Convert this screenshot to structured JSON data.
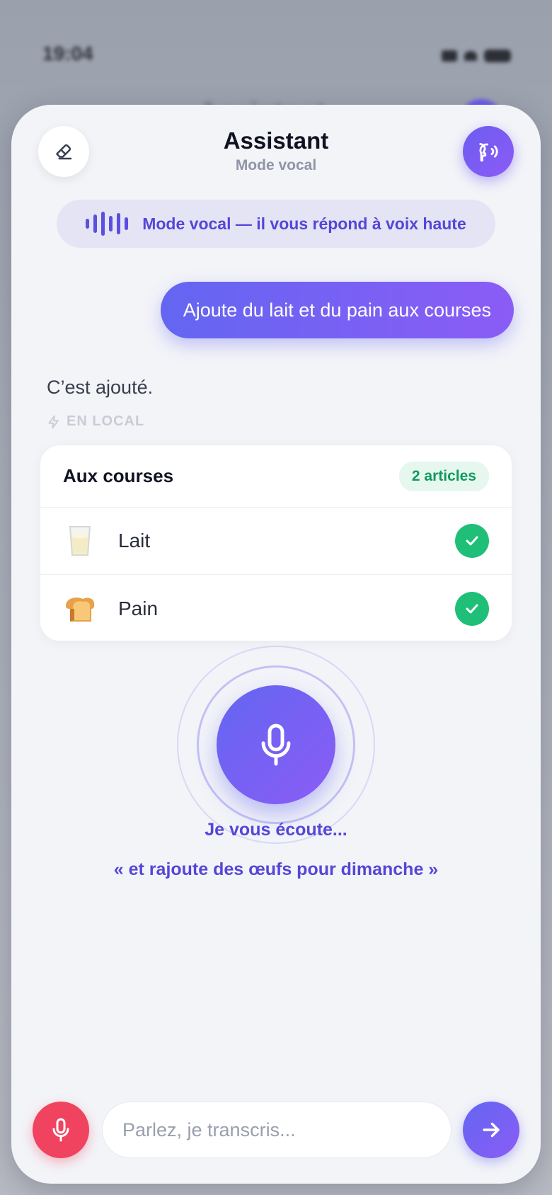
{
  "status_bar": {
    "time": "19:04"
  },
  "background": {
    "title": "Assistant"
  },
  "header": {
    "title": "Assistant",
    "subtitle": "Mode vocal",
    "clear_icon": "eraser-icon",
    "voice_icon": "speaking-head-icon"
  },
  "mode_banner": {
    "text": "Mode vocal — il vous répond à voix haute",
    "icon": "waveform-icon"
  },
  "conversation": {
    "user_message": "Ajoute du lait et du pain aux courses",
    "assistant_reply": "C’est ajouté.",
    "source_tag": "EN LOCAL"
  },
  "shopping_card": {
    "title": "Aux courses",
    "badge": "2 articles",
    "items": [
      {
        "label": "Lait",
        "icon": "milk-glass-icon",
        "checked": true
      },
      {
        "label": "Pain",
        "icon": "bread-icon",
        "checked": true
      }
    ]
  },
  "listening": {
    "status": "Je vous écoute...",
    "transcript": "« et rajoute des œufs pour dimanche »"
  },
  "composer": {
    "placeholder": "Parlez, je transcris...",
    "mic_icon": "microphone-icon",
    "send_icon": "arrow-right-icon"
  },
  "colors": {
    "accent": "#6366f1",
    "accent_2": "#8b5cf6",
    "record": "#f0435f",
    "success": "#1fbf78"
  }
}
